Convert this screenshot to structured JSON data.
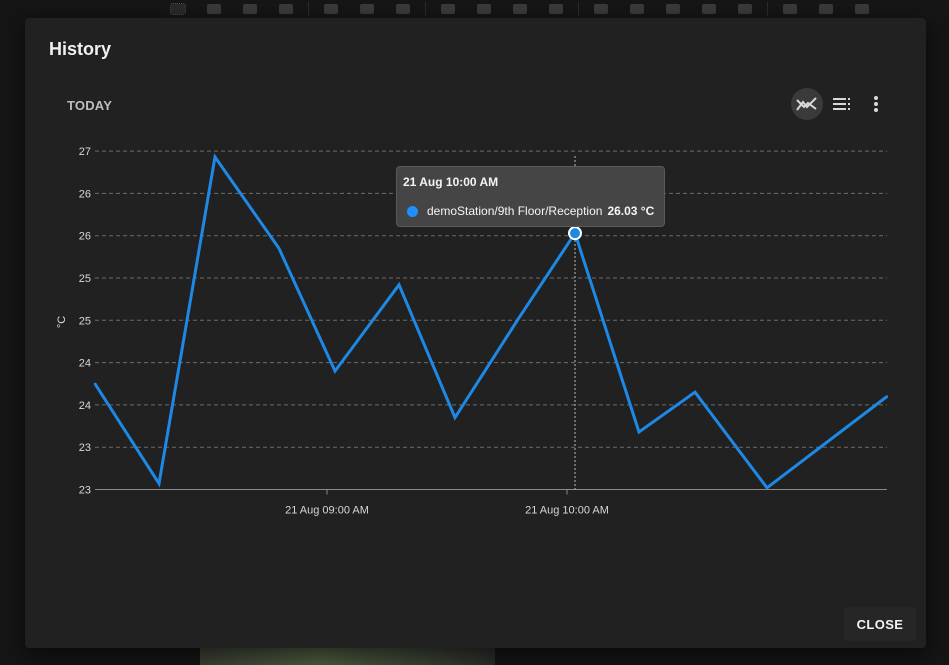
{
  "dialog": {
    "title": "History",
    "period_label": "TODAY",
    "close_label": "CLOSE"
  },
  "toolbar_icons": [
    "chart-mode-icon",
    "legend-list-icon",
    "more-vert-icon"
  ],
  "background_toolbar_icons": [
    "select-area-icon",
    "image-icon",
    "layers-icon",
    "link-icon",
    "share-icon",
    "square-icon",
    "minus-icon",
    "text-icon",
    "image-icon",
    "user-arrow-icon",
    "user-add-icon",
    "pencil-icon",
    "add-box-icon",
    "grid-icon",
    "trash-icon",
    "close-icon",
    "refresh-icon",
    "lock-icon",
    "download-icon"
  ],
  "tooltip": {
    "time": "21 Aug 10:00 AM",
    "series": "demoStation/9th Floor/Reception",
    "value": "26.03 °C",
    "marker_color": "#1e90ff"
  },
  "colors": {
    "series": "#1e88e5",
    "grid": "#6b6b6b",
    "dialog_bg": "#212121"
  },
  "chart_data": {
    "type": "line",
    "ylabel": "°C",
    "ylim": [
      22.9,
      27.06
    ],
    "y_ticks": [
      {
        "value": 27.0,
        "label": "27"
      },
      {
        "value": 26.5,
        "label": "26"
      },
      {
        "value": 26.0,
        "label": "26"
      },
      {
        "value": 25.5,
        "label": "25"
      },
      {
        "value": 25.0,
        "label": "25"
      },
      {
        "value": 24.5,
        "label": "24"
      },
      {
        "value": 24.0,
        "label": "24"
      },
      {
        "value": 23.5,
        "label": "23"
      },
      {
        "value": 23.0,
        "label": "23"
      }
    ],
    "x_range": [
      "08:01",
      "09:40"
    ],
    "x_ticks": [
      {
        "time": "08:30",
        "label": "21 Aug 09:00 AM"
      },
      {
        "time": "09:00",
        "label": "21 Aug 10:00 AM"
      }
    ],
    "grid": true,
    "legend": "none",
    "series": [
      {
        "name": "demoStation/9th Floor/Reception",
        "x": [
          "08:01",
          "08:09",
          "08:16",
          "08:24",
          "08:31",
          "08:39",
          "08:46",
          "08:54",
          "09:01",
          "09:09",
          "09:16",
          "09:25",
          "09:40"
        ],
        "y": [
          24.25,
          23.07,
          26.93,
          25.85,
          24.4,
          25.42,
          23.85,
          25.03,
          26.03,
          23.68,
          24.15,
          23.02,
          24.1
        ]
      }
    ],
    "highlight": {
      "x": "09:01",
      "y": 26.03
    }
  }
}
